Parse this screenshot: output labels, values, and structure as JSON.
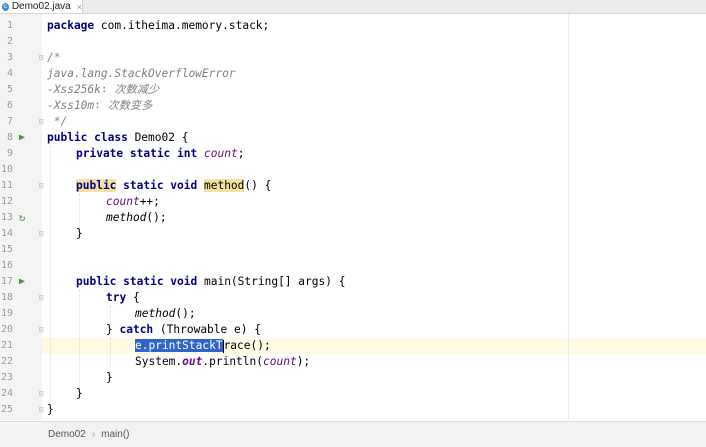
{
  "tab": {
    "label": "Demo02.java",
    "icon": "java-class-icon",
    "close": "×"
  },
  "line_numbers": [
    "1",
    "2",
    "3",
    "4",
    "5",
    "6",
    "7",
    "8",
    "9",
    "10",
    "11",
    "12",
    "13",
    "14",
    "15",
    "16",
    "17",
    "18",
    "19",
    "20",
    "21",
    "22",
    "23",
    "24",
    "25"
  ],
  "code": {
    "l1_kw": "package",
    "l1_rest": " com.itheima.memory.stack;",
    "l3": "/*",
    "l4": "java.lang.StackOverflowError",
    "l5": "-Xss256k∶ 次数减少",
    "l6": "-Xss10m∶ 次数变多",
    "l7": " */",
    "l8_kw": "public class",
    "l8_rest": " Demo02 {",
    "l9_kw": "private static int",
    "l9_field": "count",
    "l9_end": ";",
    "l11_kw1": "public",
    "l11_kw2": " static void ",
    "l11_name": "method",
    "l11_end": "() {",
    "l12_field": "count",
    "l12_end": "++;",
    "l13_call": "method",
    "l13_end": "();",
    "l14": "}",
    "l17_kw": "public static void",
    "l17_rest": " main(String[] args) {",
    "l18_kw": "try",
    "l18_rest": " {",
    "l19_call": "method",
    "l19_end": "();",
    "l20_open": "} ",
    "l20_kw": "catch",
    "l20_rest": " (Throwable e) {",
    "l21_sel": "e.printStackT",
    "l21_rest": "race();",
    "l22_a": "System.",
    "l22_out": "out",
    "l22_b": ".println(",
    "l22_field": "count",
    "l22_end": ");",
    "l23": "}",
    "l24": "}",
    "l25": "}"
  },
  "breadcrumb": {
    "class": "Demo02",
    "separator": "›",
    "method": "main()"
  },
  "colors": {
    "keyword": "#000080",
    "comment": "#808080",
    "field": "#660e7a",
    "selection": "#2f65ca",
    "current_line": "#fffae3"
  }
}
